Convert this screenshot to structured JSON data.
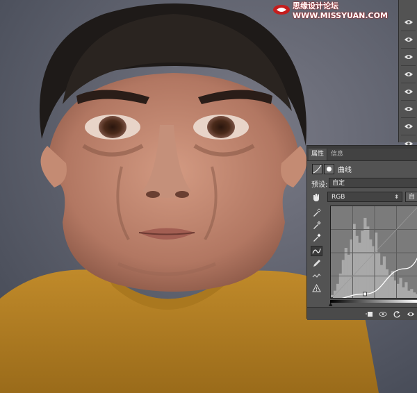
{
  "watermark": {
    "text": "思缘设计论坛 WWW.MISSYUAN.COM"
  },
  "layers": {
    "visibility_icons": [
      "eye-icon",
      "eye-icon",
      "eye-icon",
      "eye-icon",
      "eye-icon",
      "eye-icon",
      "eye-icon",
      "eye-icon"
    ]
  },
  "properties_panel": {
    "tabs": [
      {
        "label": "属性"
      },
      {
        "label": "信息"
      }
    ],
    "title": "曲线",
    "preset_label": "预设:",
    "preset_value": "自定",
    "channel_value": "RGB",
    "auto_label": "自",
    "tools": [
      "eyedropper-black-icon",
      "eyedropper-gray-icon",
      "eyedropper-white-icon",
      "curve-point-icon",
      "pencil-icon",
      "smooth-icon",
      "clipping-warning-icon"
    ],
    "bottom_icons": [
      "clip-to-layer-icon",
      "view-previous-icon",
      "reset-icon",
      "visibility-icon"
    ],
    "colors": {
      "panel_bg": "#535353",
      "graph_bg": "#7b7b7b",
      "curve": "#ffffff"
    }
  },
  "chart_data": {
    "type": "line",
    "xlim": [
      0,
      255
    ],
    "ylim": [
      0,
      255
    ],
    "grid": true,
    "curve_points": [
      [
        0,
        0
      ],
      [
        64,
        12
      ],
      [
        140,
        70
      ],
      [
        200,
        160
      ],
      [
        255,
        255
      ]
    ],
    "histogram_heights": [
      0.05,
      0.1,
      0.18,
      0.3,
      0.46,
      0.6,
      0.52,
      0.7,
      0.88,
      0.74,
      0.66,
      0.8,
      0.95,
      0.85,
      0.7,
      0.62,
      0.78,
      0.55,
      0.4,
      0.5,
      0.35,
      0.28,
      0.33,
      0.22,
      0.18,
      0.25,
      0.14,
      0.2,
      0.1,
      0.12,
      0.08,
      0.06
    ]
  }
}
